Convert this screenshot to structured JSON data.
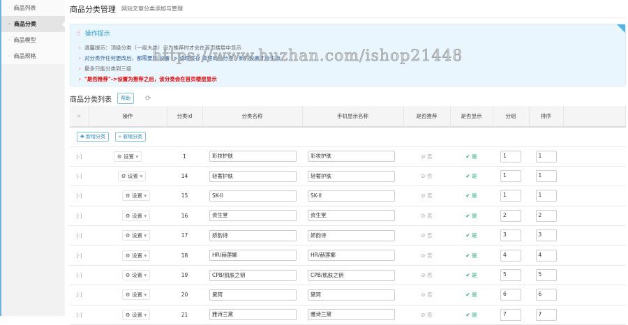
{
  "sidebar": {
    "items": [
      {
        "label": "商品列表"
      },
      {
        "label": "商品分类",
        "active": true
      },
      {
        "label": "商品模型"
      },
      {
        "label": "商品规格"
      }
    ]
  },
  "header": {
    "title": "商品分类管理",
    "subtitle": "网站文章分类添加与管理"
  },
  "tips": {
    "title": "操作提示",
    "items": [
      {
        "text": "温馨提示：顶级分类（一级大类）设为推荐时才会在首页楼层中显示",
        "style": ""
      },
      {
        "text": "对分类作任何更改后，都需要到 设置 -> 清理缓存 清理商品分类，新的设置才会生效",
        "style": "blue"
      },
      {
        "text": "最多只能分类到三级",
        "style": ""
      },
      {
        "text": "\"是否推荐\"->设置为推荐之后，该分类会在首页楼层显示",
        "style": "red"
      }
    ]
  },
  "watermark": "https://www.huzhan.com/ishop21448",
  "list": {
    "title": "商品分类列表",
    "help_label": "帮助",
    "add_label": "新增分类",
    "collapse_label": "收缩分类",
    "columns": [
      "操作",
      "分类id",
      "分类名称",
      "手机显示名称",
      "是否推荐",
      "是否显示",
      "分组",
      "排序"
    ],
    "settings_label": "设置",
    "no_label": "否",
    "yes_label": "是",
    "expander": "[-]",
    "rows": [
      {
        "id": "1",
        "name": "彩妆护肤",
        "mobile": "彩妆护肤",
        "group": "1",
        "sort": "1",
        "level": 1
      },
      {
        "id": "14",
        "name": "轻奢护肤",
        "mobile": "轻奢护肤",
        "group": "1",
        "sort": "1",
        "level": 2
      },
      {
        "id": "15",
        "name": "SK-II",
        "mobile": "SK-II",
        "group": "1",
        "sort": "1",
        "level": 3
      },
      {
        "id": "16",
        "name": "资生堂",
        "mobile": "资生堂",
        "group": "2",
        "sort": "2",
        "level": 3
      },
      {
        "id": "17",
        "name": "娇韵诗",
        "mobile": "娇韵诗",
        "group": "3",
        "sort": "3",
        "level": 3
      },
      {
        "id": "18",
        "name": "HR/赫莲娜",
        "mobile": "HR/赫莲娜",
        "group": "4",
        "sort": "4",
        "level": 3
      },
      {
        "id": "19",
        "name": "CPB/肌肤之钥",
        "mobile": "CPB/肌肤之钥",
        "group": "5",
        "sort": "5",
        "level": 3
      },
      {
        "id": "20",
        "name": "黛珂",
        "mobile": "黛珂",
        "group": "6",
        "sort": "6",
        "level": 3
      },
      {
        "id": "21",
        "name": "雅诗兰黛",
        "mobile": "雅诗兰黛",
        "group": "7",
        "sort": "7",
        "level": 3
      }
    ]
  }
}
